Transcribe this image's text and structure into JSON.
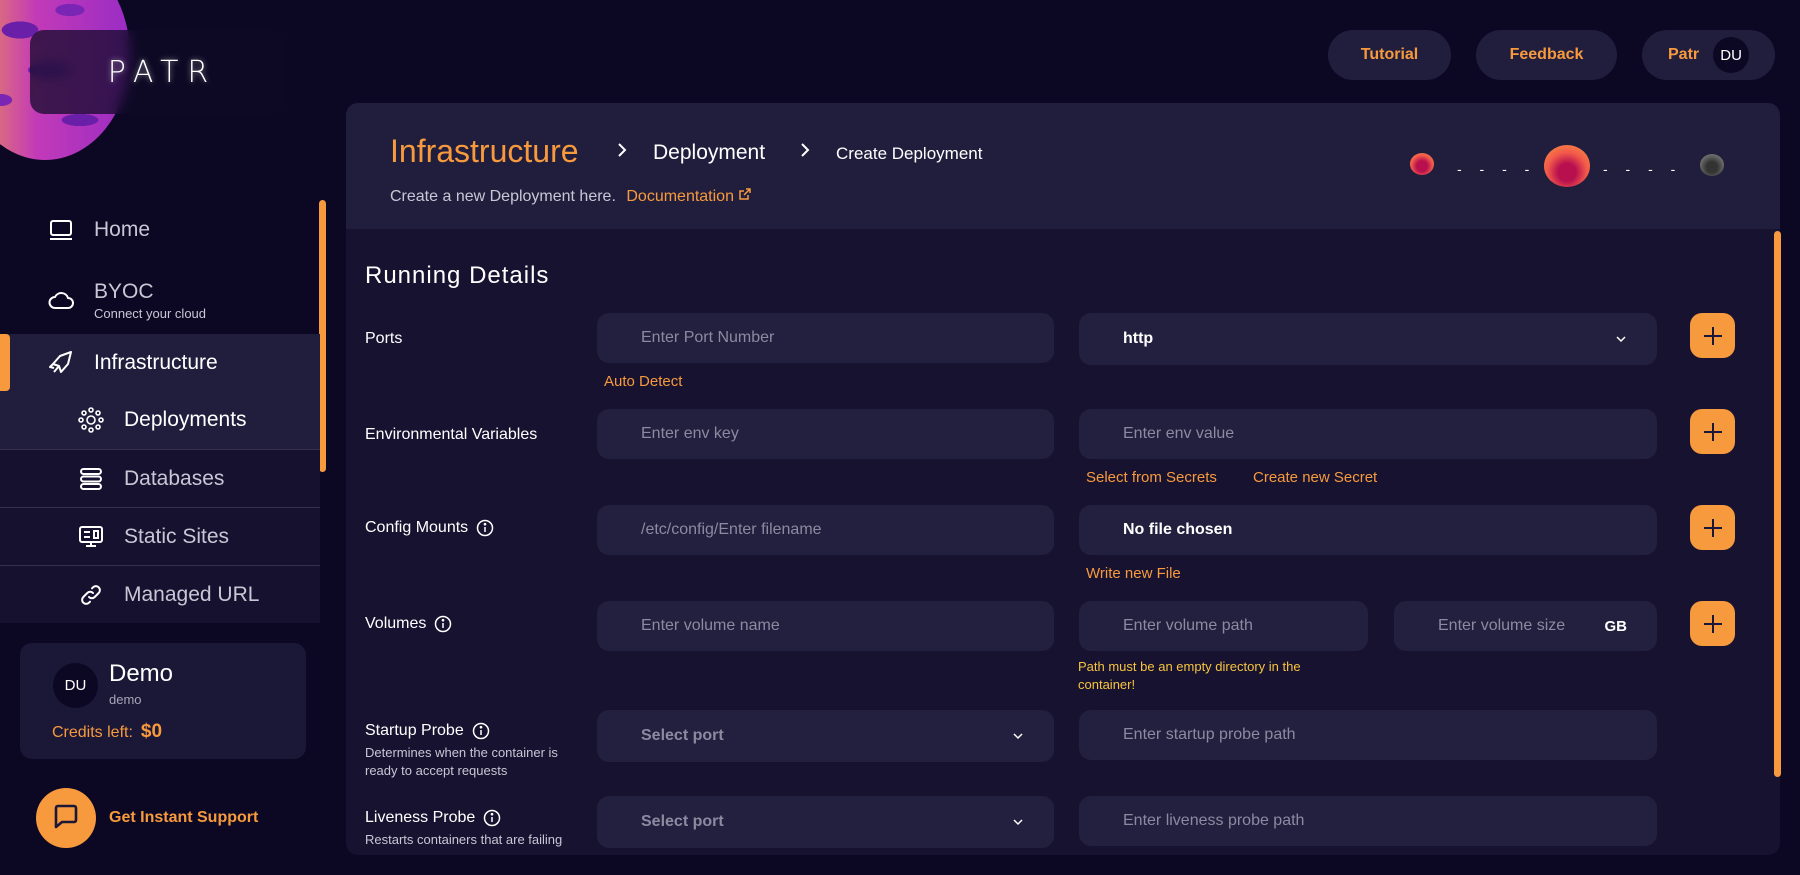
{
  "app": {
    "logo_text": "PATR"
  },
  "topbar": {
    "tutorial_label": "Tutorial",
    "feedback_label": "Feedback",
    "workspace_label": "Patr",
    "avatar_initials": "DU"
  },
  "sidebar": {
    "items": [
      {
        "label": "Home",
        "icon": "laptop-icon"
      },
      {
        "label": "BYOC",
        "sublabel": "Connect your cloud",
        "icon": "cloud-icon"
      },
      {
        "label": "Infrastructure",
        "icon": "rocket-icon",
        "active": true
      },
      {
        "label": "Deployments",
        "icon": "network-icon",
        "active": true
      },
      {
        "label": "Databases",
        "icon": "database-icon"
      },
      {
        "label": "Static Sites",
        "icon": "monitor-icon"
      },
      {
        "label": "Managed URL",
        "icon": "link-icon"
      }
    ],
    "user": {
      "initials": "DU",
      "name": "Demo",
      "username": "demo",
      "credits_label": "Credits left:",
      "credits_value": "$0"
    },
    "support_label": "Get Instant Support"
  },
  "header": {
    "breadcrumb": [
      "Infrastructure",
      "Deployment",
      "Create Deployment"
    ],
    "subtitle": "Create a new Deployment here.",
    "doc_link": "Documentation",
    "progress_dashes": "- - - -"
  },
  "form": {
    "section_title": "Running Details",
    "ports": {
      "label": "Ports",
      "port_placeholder": "Enter Port Number",
      "protocol_value": "http",
      "auto_detect": "Auto Detect"
    },
    "env": {
      "label": "Environmental Variables",
      "key_placeholder": "Enter env key",
      "value_placeholder": "Enter env value",
      "select_secrets": "Select from Secrets",
      "create_secret": "Create new Secret"
    },
    "config": {
      "label": "Config Mounts",
      "prefix": "/etc/config/",
      "filename_placeholder": "Enter filename",
      "file_status": "No file chosen",
      "write_file": "Write new File"
    },
    "volumes": {
      "label": "Volumes",
      "name_placeholder": "Enter volume name",
      "path_placeholder": "Enter volume path",
      "size_placeholder": "Enter volume size",
      "size_unit": "GB",
      "warning": "Path must be an empty directory in the container!"
    },
    "startup_probe": {
      "label": "Startup Probe",
      "description": "Determines when the container is ready to accept requests",
      "port_placeholder": "Select port",
      "path_placeholder": "Enter startup probe path"
    },
    "liveness_probe": {
      "label": "Liveness Probe",
      "description": "Restarts containers that are failing",
      "port_placeholder": "Select port",
      "path_placeholder": "Enter liveness probe path"
    }
  },
  "colors": {
    "accent": "#f79a3e",
    "background": "#0c0823",
    "card": "#211e3d",
    "content": "#17122f",
    "warning": "#f7c43e"
  }
}
